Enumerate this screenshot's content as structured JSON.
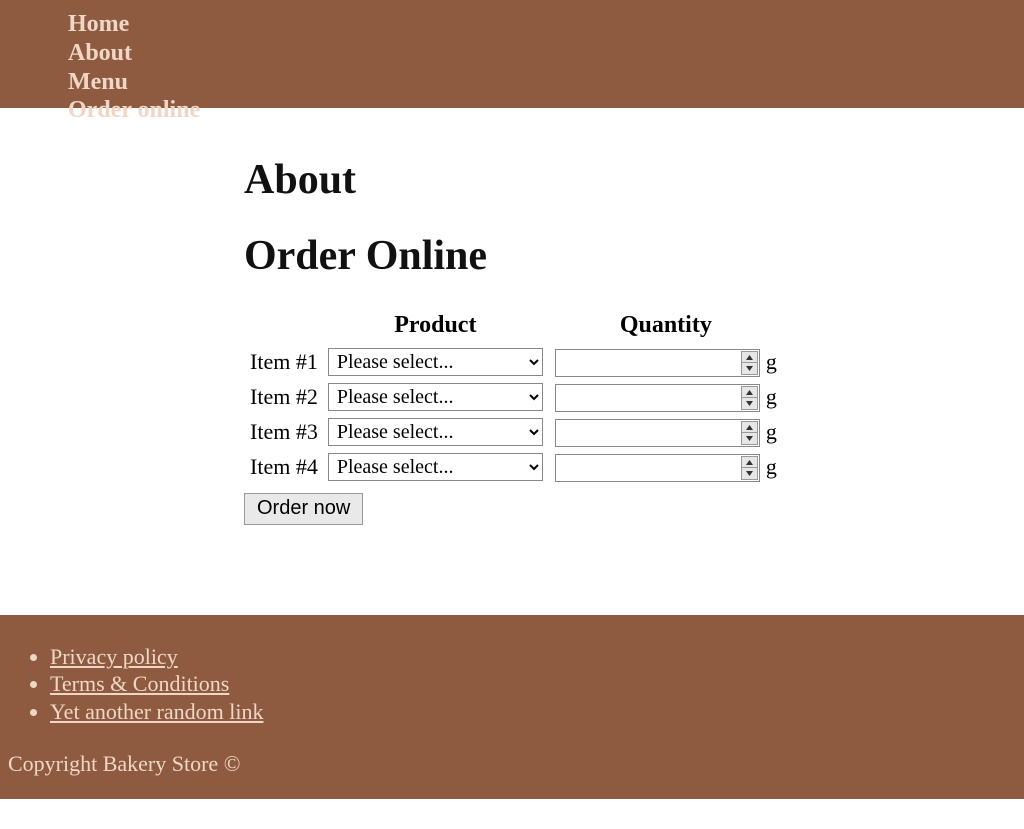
{
  "nav": {
    "items": [
      {
        "label": "Home"
      },
      {
        "label": "About"
      },
      {
        "label": "Menu"
      },
      {
        "label": "Order online"
      }
    ]
  },
  "headings": {
    "about": "About",
    "order_online": "Order Online"
  },
  "table": {
    "col_product": "Product",
    "col_quantity": "Quantity",
    "select_placeholder": "Please select...",
    "unit": "g",
    "rows": [
      {
        "label": "Item #1"
      },
      {
        "label": "Item #2"
      },
      {
        "label": "Item #3"
      },
      {
        "label": "Item #4"
      }
    ]
  },
  "buttons": {
    "order_now": "Order now"
  },
  "footer": {
    "links": [
      {
        "label": "Privacy policy"
      },
      {
        "label": "Terms & Conditions"
      },
      {
        "label": "Yet another random link"
      }
    ],
    "copyright": "Copyright Bakery Store ©"
  }
}
